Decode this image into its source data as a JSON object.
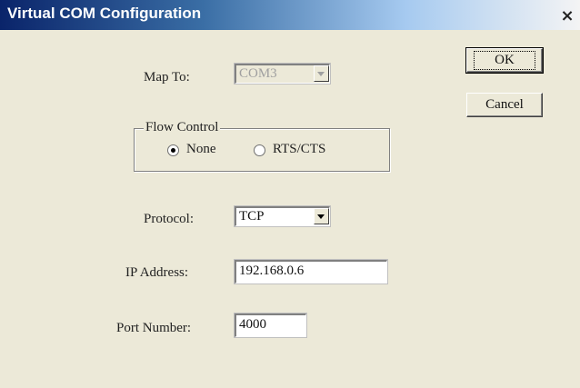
{
  "window": {
    "title": "Virtual COM Configuration",
    "close_glyph": "×"
  },
  "map_to": {
    "label": "Map To:",
    "value": "COM3",
    "enabled": false
  },
  "flow_control": {
    "legend": "Flow Control",
    "options": [
      {
        "label": "None",
        "checked": true
      },
      {
        "label": "RTS/CTS",
        "checked": false
      }
    ]
  },
  "protocol": {
    "label": "Protocol:",
    "value": "TCP"
  },
  "ip_address": {
    "label": "IP Address:",
    "value": "192.168.0.6"
  },
  "port_number": {
    "label": "Port Number:",
    "value": "4000"
  },
  "buttons": {
    "ok": "OK",
    "cancel": "Cancel"
  },
  "icons": {
    "close": "close-icon",
    "dropdown": "chevron-down-icon",
    "radio": "radio-button"
  }
}
